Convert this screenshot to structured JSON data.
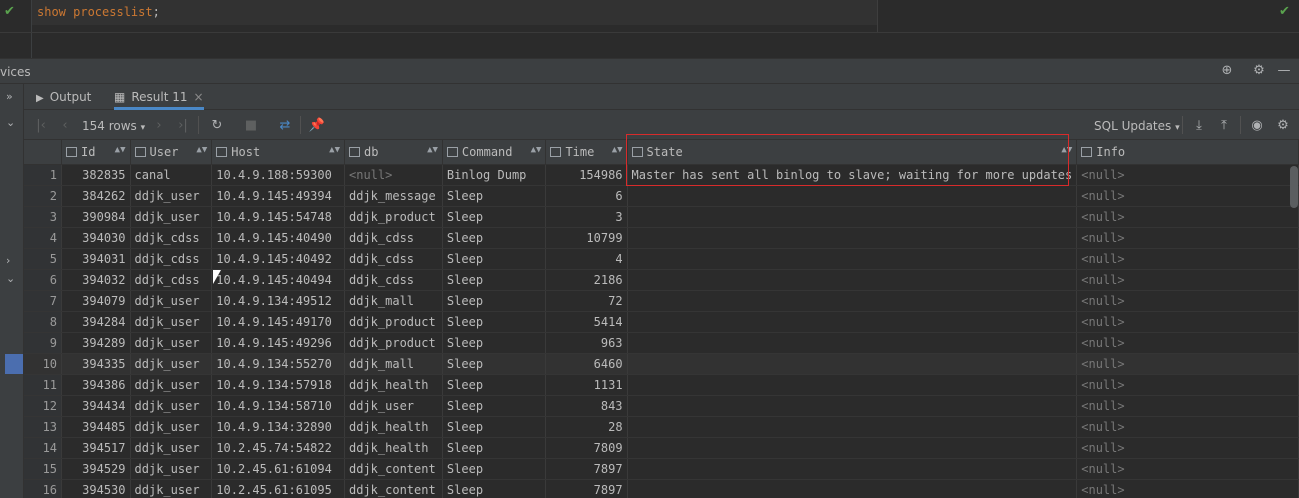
{
  "editor": {
    "sql_keyword": "show processlist",
    "sql_end": ";"
  },
  "services": {
    "title": "vices"
  },
  "tabs": [
    {
      "label": "Output"
    },
    {
      "label": "Result 11"
    }
  ],
  "toolbar": {
    "row_count": "154 rows",
    "sql_updates": "SQL Updates"
  },
  "columns": [
    "Id",
    "User",
    "Host",
    "db",
    "Command",
    "Time",
    "State",
    "Info"
  ],
  "rows": [
    {
      "n": "1",
      "id": "382835",
      "user": "canal",
      "host": "10.4.9.188:59300",
      "db": "<null>",
      "command": "Binlog Dump",
      "time": "154986",
      "state": "Master has sent all binlog to slave; waiting for more updates",
      "info": "<null>"
    },
    {
      "n": "2",
      "id": "384262",
      "user": "ddjk_user",
      "host": "10.4.9.145:49394",
      "db": "ddjk_message",
      "command": "Sleep",
      "time": "6",
      "state": "",
      "info": "<null>"
    },
    {
      "n": "3",
      "id": "390984",
      "user": "ddjk_user",
      "host": "10.4.9.145:54748",
      "db": "ddjk_product",
      "command": "Sleep",
      "time": "3",
      "state": "",
      "info": "<null>"
    },
    {
      "n": "4",
      "id": "394030",
      "user": "ddjk_cdss",
      "host": "10.4.9.145:40490",
      "db": "ddjk_cdss",
      "command": "Sleep",
      "time": "10799",
      "state": "",
      "info": "<null>"
    },
    {
      "n": "5",
      "id": "394031",
      "user": "ddjk_cdss",
      "host": "10.4.9.145:40492",
      "db": "ddjk_cdss",
      "command": "Sleep",
      "time": "4",
      "state": "",
      "info": "<null>"
    },
    {
      "n": "6",
      "id": "394032",
      "user": "ddjk_cdss",
      "host": "10.4.9.145:40494",
      "db": "ddjk_cdss",
      "command": "Sleep",
      "time": "2186",
      "state": "",
      "info": "<null>"
    },
    {
      "n": "7",
      "id": "394079",
      "user": "ddjk_user",
      "host": "10.4.9.134:49512",
      "db": "ddjk_mall",
      "command": "Sleep",
      "time": "72",
      "state": "",
      "info": "<null>"
    },
    {
      "n": "8",
      "id": "394284",
      "user": "ddjk_user",
      "host": "10.4.9.145:49170",
      "db": "ddjk_product",
      "command": "Sleep",
      "time": "5414",
      "state": "",
      "info": "<null>"
    },
    {
      "n": "9",
      "id": "394289",
      "user": "ddjk_user",
      "host": "10.4.9.145:49296",
      "db": "ddjk_product",
      "command": "Sleep",
      "time": "963",
      "state": "",
      "info": "<null>"
    },
    {
      "n": "10",
      "id": "394335",
      "user": "ddjk_user",
      "host": "10.4.9.134:55270",
      "db": "ddjk_mall",
      "command": "Sleep",
      "time": "6460",
      "state": "",
      "info": "<null>"
    },
    {
      "n": "11",
      "id": "394386",
      "user": "ddjk_user",
      "host": "10.4.9.134:57918",
      "db": "ddjk_health",
      "command": "Sleep",
      "time": "1131",
      "state": "",
      "info": "<null>"
    },
    {
      "n": "12",
      "id": "394434",
      "user": "ddjk_user",
      "host": "10.4.9.134:58710",
      "db": "ddjk_user",
      "command": "Sleep",
      "time": "843",
      "state": "",
      "info": "<null>"
    },
    {
      "n": "13",
      "id": "394485",
      "user": "ddjk_user",
      "host": "10.4.9.134:32890",
      "db": "ddjk_health",
      "command": "Sleep",
      "time": "28",
      "state": "",
      "info": "<null>"
    },
    {
      "n": "14",
      "id": "394517",
      "user": "ddjk_user",
      "host": "10.2.45.74:54822",
      "db": "ddjk_health",
      "command": "Sleep",
      "time": "7809",
      "state": "",
      "info": "<null>"
    },
    {
      "n": "15",
      "id": "394529",
      "user": "ddjk_user",
      "host": "10.2.45.61:61094",
      "db": "ddjk_content",
      "command": "Sleep",
      "time": "7897",
      "state": "",
      "info": "<null>"
    },
    {
      "n": "16",
      "id": "394530",
      "user": "ddjk_user",
      "host": "10.2.45.61:61095",
      "db": "ddjk_content",
      "command": "Sleep",
      "time": "7897",
      "state": "",
      "info": "<null>"
    }
  ]
}
